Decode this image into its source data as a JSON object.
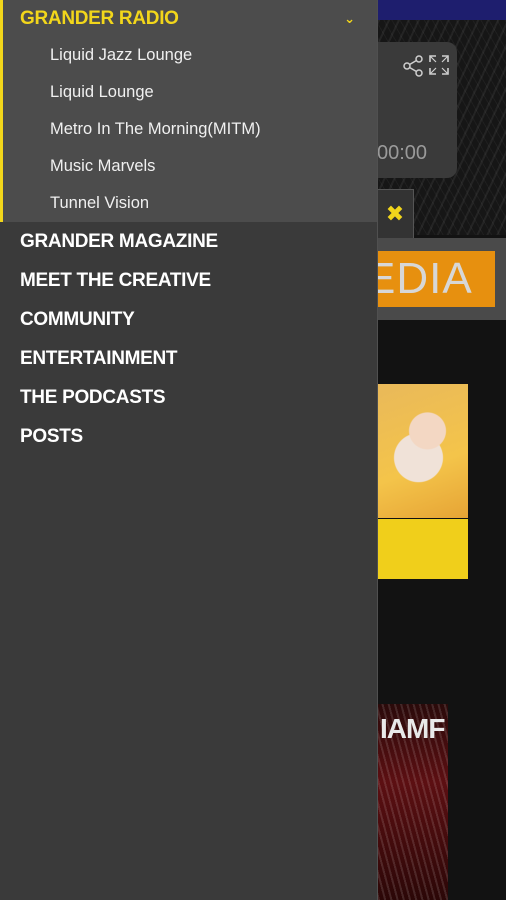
{
  "background": {
    "player_time": "00:00",
    "close_label": "✖",
    "media_banner_text": "EDIA",
    "poster_text": "IAMF"
  },
  "drawer": {
    "active_section": {
      "title": "GRANDER RADIO",
      "chevron": "⌄",
      "items": [
        {
          "label": "Liquid Jazz Lounge"
        },
        {
          "label": "Liquid Lounge"
        },
        {
          "label": "Metro In The Morning(MITM)"
        },
        {
          "label": "Music Marvels"
        },
        {
          "label": "Tunnel Vision"
        }
      ]
    },
    "items": [
      {
        "label": "GRANDER MAGAZINE"
      },
      {
        "label": "MEET THE CREATIVE"
      },
      {
        "label": "COMMUNITY"
      },
      {
        "label": "ENTERTAINMENT"
      },
      {
        "label": "THE PODCASTS"
      },
      {
        "label": "POSTS"
      }
    ]
  },
  "colors": {
    "accent": "#f2d61b",
    "drawer_bg": "#3a3a3a",
    "active_bg": "#4c4c4c"
  },
  "icons": [
    "share-icon",
    "expand-icon",
    "close-icon",
    "chevron-down-icon"
  ]
}
